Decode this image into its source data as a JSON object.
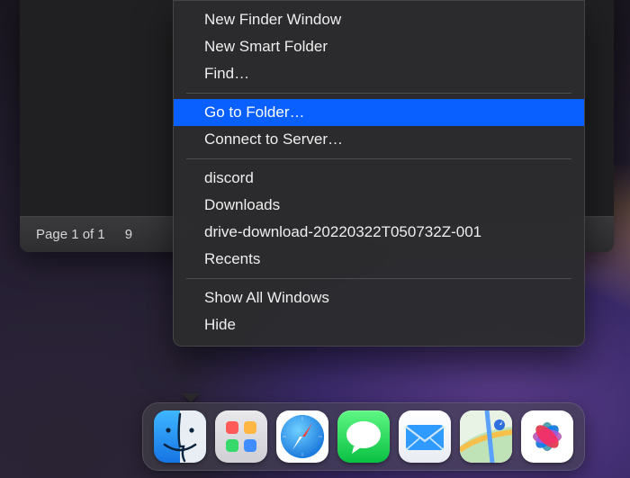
{
  "window": {
    "status": {
      "page": "Page 1 of 1",
      "extra": "9"
    }
  },
  "menu": {
    "groups": [
      [
        {
          "id": "new-finder-window",
          "label": "New Finder Window",
          "highlight": false
        },
        {
          "id": "new-smart-folder",
          "label": "New Smart Folder",
          "highlight": false
        },
        {
          "id": "find",
          "label": "Find…",
          "highlight": false
        }
      ],
      [
        {
          "id": "go-to-folder",
          "label": "Go to Folder…",
          "highlight": true
        },
        {
          "id": "connect-to-server",
          "label": "Connect to Server…",
          "highlight": false
        }
      ],
      [
        {
          "id": "recent-discord",
          "label": "discord",
          "highlight": false
        },
        {
          "id": "recent-downloads",
          "label": "Downloads",
          "highlight": false
        },
        {
          "id": "recent-drive-download",
          "label": "drive-download-20220322T050732Z-001",
          "highlight": false
        },
        {
          "id": "recent-recents",
          "label": "Recents",
          "highlight": false
        }
      ],
      [
        {
          "id": "show-all-windows",
          "label": "Show All Windows",
          "highlight": false
        },
        {
          "id": "hide",
          "label": "Hide",
          "highlight": false
        }
      ]
    ]
  },
  "dock": {
    "items": [
      {
        "id": "finder",
        "name": "Finder"
      },
      {
        "id": "launchpad",
        "name": "Launchpad"
      },
      {
        "id": "safari",
        "name": "Safari"
      },
      {
        "id": "messages",
        "name": "Messages"
      },
      {
        "id": "mail",
        "name": "Mail"
      },
      {
        "id": "maps",
        "name": "Maps"
      },
      {
        "id": "photos",
        "name": "Photos"
      }
    ]
  }
}
